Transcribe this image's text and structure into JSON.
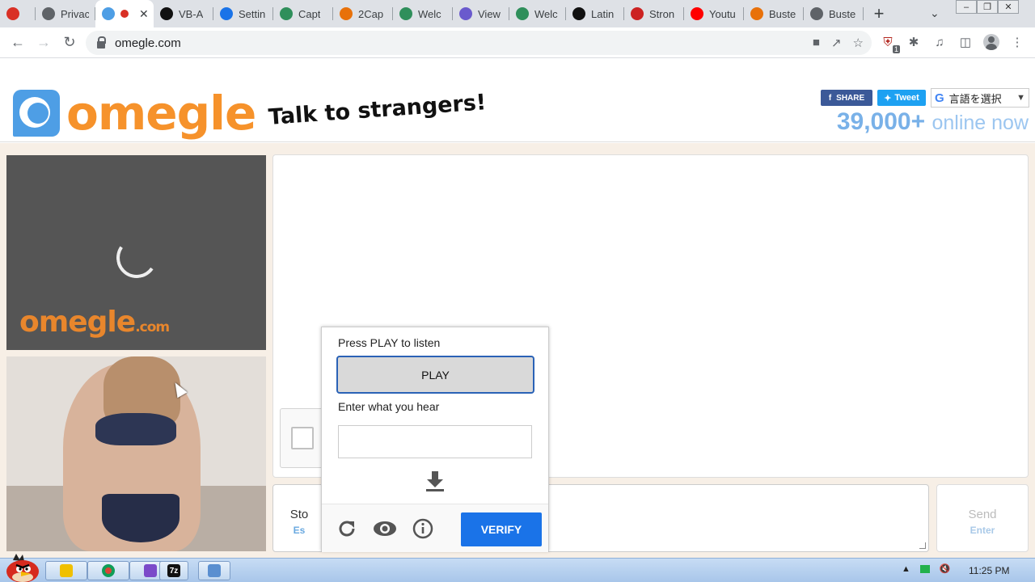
{
  "browser": {
    "tabs": [
      {
        "title": "",
        "favicon": "recording-dot-icon",
        "color": "#d93025",
        "active": false
      },
      {
        "title": "Privac",
        "favicon": "globe-icon",
        "color": "#5f6368",
        "active": false
      },
      {
        "title": "",
        "favicon": "omegle-icon",
        "color": "#4e9ee5",
        "active": true
      },
      {
        "title": "VB-A",
        "favicon": "vb-icon",
        "color": "#111111",
        "active": false
      },
      {
        "title": "Settin",
        "favicon": "gear-icon",
        "color": "#1a73e8",
        "active": false
      },
      {
        "title": "Capt",
        "favicon": "captcha-icon",
        "color": "#2f8f5b",
        "active": false
      },
      {
        "title": "2Cap",
        "favicon": "rainbow-icon",
        "color": "#e8710a",
        "active": false
      },
      {
        "title": "Welc",
        "favicon": "captcha-icon",
        "color": "#2f8f5b",
        "active": false
      },
      {
        "title": "View",
        "favicon": "at-icon",
        "color": "#6a5acd",
        "active": false
      },
      {
        "title": "Welc",
        "favicon": "captcha-icon",
        "color": "#2f8f5b",
        "active": false
      },
      {
        "title": "Latin",
        "favicon": "wikipedia-icon",
        "color": "#111111",
        "active": false
      },
      {
        "title": "Stron",
        "favicon": "pinterest-icon",
        "color": "#cc2222",
        "active": false
      },
      {
        "title": "Youtu",
        "favicon": "youtube-icon",
        "color": "#ff0000",
        "active": false
      },
      {
        "title": "Buste",
        "favicon": "rainbow-icon",
        "color": "#e8710a",
        "active": false
      },
      {
        "title": "Buste",
        "favicon": "globe-icon",
        "color": "#5f6368",
        "active": false
      }
    ],
    "url": "omegle.com",
    "extension_badge": "1"
  },
  "site": {
    "logo_text": "omegle",
    "tagline": "Talk to strangers!",
    "share_label": "SHARE",
    "tweet_label": "Tweet",
    "translate_label": "言語を選択",
    "online_count": "39,000+",
    "online_label": "online now",
    "brand_orange": "#f6922b",
    "brand_blue": "#4e9ee5"
  },
  "video": {
    "watermark_main": "omegle",
    "watermark_suffix": ".com"
  },
  "chat": {
    "stop_label": "Sto",
    "stop_key": "Es",
    "send_label": "Send",
    "send_key": "Enter"
  },
  "captcha_audio": {
    "play_prompt": "Press PLAY to listen",
    "play_button": "PLAY",
    "answer_prompt": "Enter what you hear",
    "answer_value": "",
    "verify_button": "VERIFY",
    "verify_color": "#1a73e8"
  },
  "taskbar": {
    "clock": "11:25 PM"
  }
}
